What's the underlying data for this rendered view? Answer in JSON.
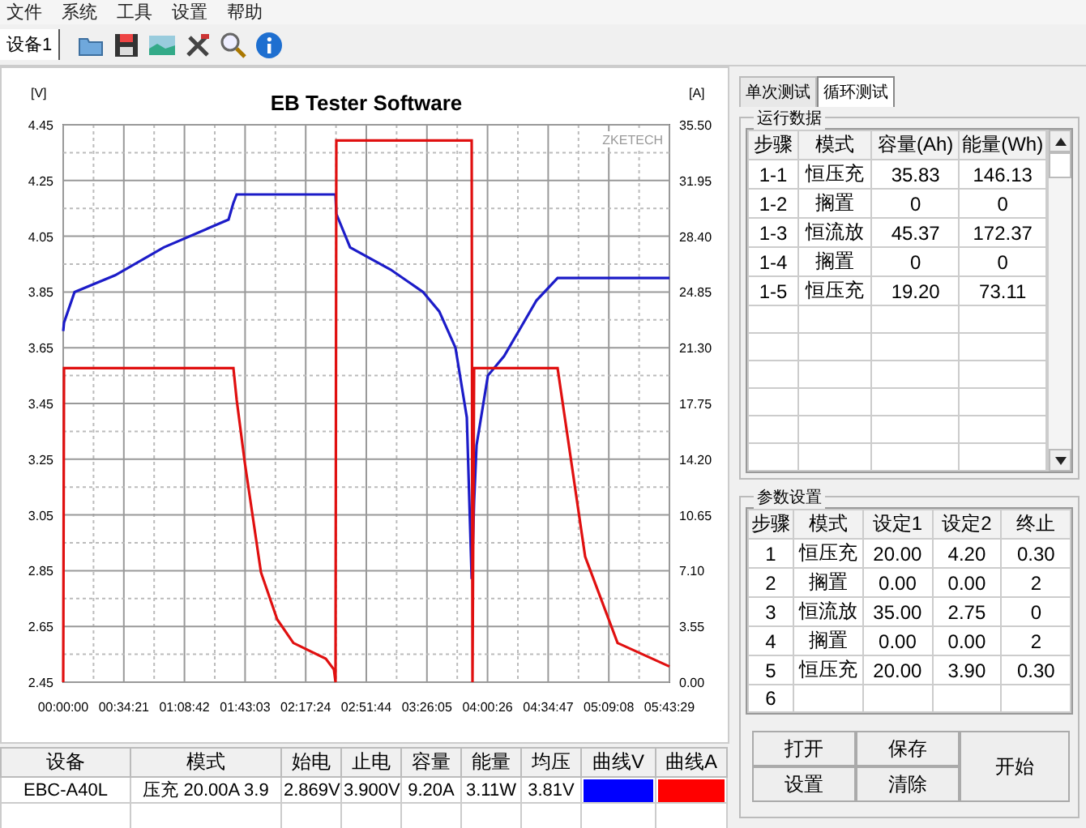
{
  "menu": [
    "文件",
    "系统",
    "工具",
    "设置",
    "帮助"
  ],
  "device_tabs": [
    {
      "label": "设备1",
      "selected": true
    }
  ],
  "chart": {
    "brand": "ZKETECH",
    "voltage": {
      "chart_data": {
        "type": "line",
        "grid": true,
        "title": "EB Tester Software",
        "ylabel": "[V]",
        "xlim": [
          0,
          20609
        ],
        "ylim": [
          2.45,
          4.45
        ],
        "yticks": [
          {
            "value": 2.45,
            "label": "2.45"
          },
          {
            "value": 2.65,
            "label": "2.65"
          },
          {
            "value": 2.85,
            "label": "2.85"
          },
          {
            "value": 3.05,
            "label": "3.05"
          },
          {
            "value": 3.25,
            "label": "3.25"
          },
          {
            "value": 3.45,
            "label": "3.45"
          },
          {
            "value": 3.65,
            "label": "3.65"
          },
          {
            "value": 3.85,
            "label": "3.85"
          },
          {
            "value": 4.05,
            "label": "4.05"
          },
          {
            "value": 4.25,
            "label": "4.25"
          },
          {
            "value": 4.45,
            "label": "4.45"
          }
        ],
        "xticks": [
          {
            "value": 0,
            "label": "00:00:00"
          },
          {
            "value": 2061,
            "label": "00:34:21"
          },
          {
            "value": 4122,
            "label": "01:08:42"
          },
          {
            "value": 6183,
            "label": "01:43:03"
          },
          {
            "value": 8244,
            "label": "02:17:24"
          },
          {
            "value": 10304,
            "label": "02:51:44"
          },
          {
            "value": 12365,
            "label": "03:26:05"
          },
          {
            "value": 14426,
            "label": "04:00:26"
          },
          {
            "value": 16487,
            "label": "04:34:47"
          },
          {
            "value": 18548,
            "label": "05:09:08"
          },
          {
            "value": 20609,
            "label": "05:43:29"
          }
        ],
        "x": [
          0,
          28,
          386,
          1763,
          3416,
          5620,
          5786,
          5896,
          6171,
          6722,
          7273,
          7824,
          8926,
          9202,
          9257,
          9284,
          9753,
          11130,
          12232,
          12783,
          13334,
          13720,
          13885,
          13913,
          13968,
          14051,
          14436,
          14987,
          15538,
          16089,
          16806,
          17742,
          18844,
          20607
        ],
        "series": [
          {
            "color": "#1c1cc8",
            "values": [
              3.71,
              3.74,
              3.85,
              3.91,
              4.01,
              4.11,
              4.17,
              4.2,
              4.2,
              4.2,
              4.2,
              4.2,
              4.2,
              4.2,
              4.2,
              4.13,
              4.01,
              3.93,
              3.85,
              3.78,
              3.65,
              3.4,
              2.82,
              2.9,
              3.1,
              3.3,
              3.55,
              3.62,
              3.72,
              3.82,
              3.9,
              3.9,
              3.9,
              3.9
            ]
          }
        ]
      }
    },
    "current": {
      "chart_data": {
        "type": "line",
        "ylabel": "[A]",
        "xlim": [
          0,
          20609
        ],
        "ylim": [
          0,
          35.5
        ],
        "yticks": [
          {
            "value": 0,
            "label": "0.00"
          },
          {
            "value": 3.55,
            "label": "3.55"
          },
          {
            "value": 7.1,
            "label": "7.10"
          },
          {
            "value": 10.65,
            "label": "10.65"
          },
          {
            "value": 14.2,
            "label": "14.20"
          },
          {
            "value": 17.75,
            "label": "17.75"
          },
          {
            "value": 21.3,
            "label": "21.30"
          },
          {
            "value": 24.85,
            "label": "24.85"
          },
          {
            "value": 28.4,
            "label": "28.40"
          },
          {
            "value": 31.95,
            "label": "31.95"
          },
          {
            "value": 35.5,
            "label": "35.50"
          }
        ],
        "x": [
          0,
          28,
          386,
          1763,
          3416,
          5620,
          5786,
          5896,
          6171,
          6722,
          7273,
          7824,
          8926,
          9202,
          9257,
          9284,
          9753,
          11130,
          12232,
          12783,
          13334,
          13720,
          13885,
          13913,
          13968,
          14051,
          14436,
          14987,
          15538,
          16089,
          16806,
          17742,
          18844,
          20607
        ],
        "series": [
          {
            "color": "#e01010",
            "values": [
              0,
              20,
              20,
              20,
              20,
              20,
              20,
              18,
              14,
              7,
              4,
              2.5,
              1.5,
              0.8,
              0,
              34.5,
              34.5,
              34.5,
              34.5,
              34.5,
              34.5,
              34.5,
              34.5,
              0,
              20,
              20,
              20,
              20,
              20,
              20,
              20,
              8,
              2.5,
              1
            ]
          }
        ]
      }
    }
  },
  "device_table": {
    "columns": [
      "设备",
      "模式",
      "始电",
      "止电",
      "容量",
      "能量",
      "均压",
      "曲线V",
      "曲线A"
    ],
    "rows": [
      [
        {
          "kind": "text",
          "text": "EBC-A40L"
        },
        {
          "kind": "text",
          "text": "压充  20.00A  3.9"
        },
        {
          "kind": "text",
          "text": "2.869V"
        },
        {
          "kind": "text",
          "text": "3.900V"
        },
        {
          "kind": "text",
          "text": "9.20A"
        },
        {
          "kind": "text",
          "text": "3.11W"
        },
        {
          "kind": "text",
          "text": "3.81V"
        },
        {
          "kind": "swatch",
          "color": "#0000ff"
        },
        {
          "kind": "swatch",
          "color": "#ff0000"
        }
      ]
    ]
  },
  "test_tabs": [
    {
      "label": "单次测试",
      "selected": false
    },
    {
      "label": "循环测试",
      "selected": true
    }
  ],
  "run_data": {
    "title": "运行数据",
    "columns": [
      "步骤",
      "模式",
      "容量(Ah)",
      "能量(Wh)"
    ],
    "rows": [
      [
        "1-1",
        "恒压充",
        "35.83",
        "146.13"
      ],
      [
        "1-2",
        "搁置",
        "0",
        "0"
      ],
      [
        "1-3",
        "恒流放",
        "45.37",
        "172.37"
      ],
      [
        "1-4",
        "搁置",
        "0",
        "0"
      ],
      [
        "1-5",
        "恒压充",
        "19.20",
        "73.11"
      ]
    ]
  },
  "params": {
    "title": "参数设置",
    "columns": [
      "步骤",
      "模式",
      "设定1",
      "设定2",
      "终止"
    ],
    "rows": [
      [
        "1",
        "恒压充",
        "20.00",
        "4.20",
        "0.30"
      ],
      [
        "2",
        "搁置",
        "0.00",
        "0.00",
        "2"
      ],
      [
        "3",
        "恒流放",
        "35.00",
        "2.75",
        "0"
      ],
      [
        "4",
        "搁置",
        "0.00",
        "0.00",
        "2"
      ],
      [
        "5",
        "恒压充",
        "20.00",
        "3.90",
        "0.30"
      ],
      [
        "6"
      ]
    ]
  },
  "buttons": [
    "打开",
    "保存",
    "开始",
    "设置",
    "清除"
  ]
}
